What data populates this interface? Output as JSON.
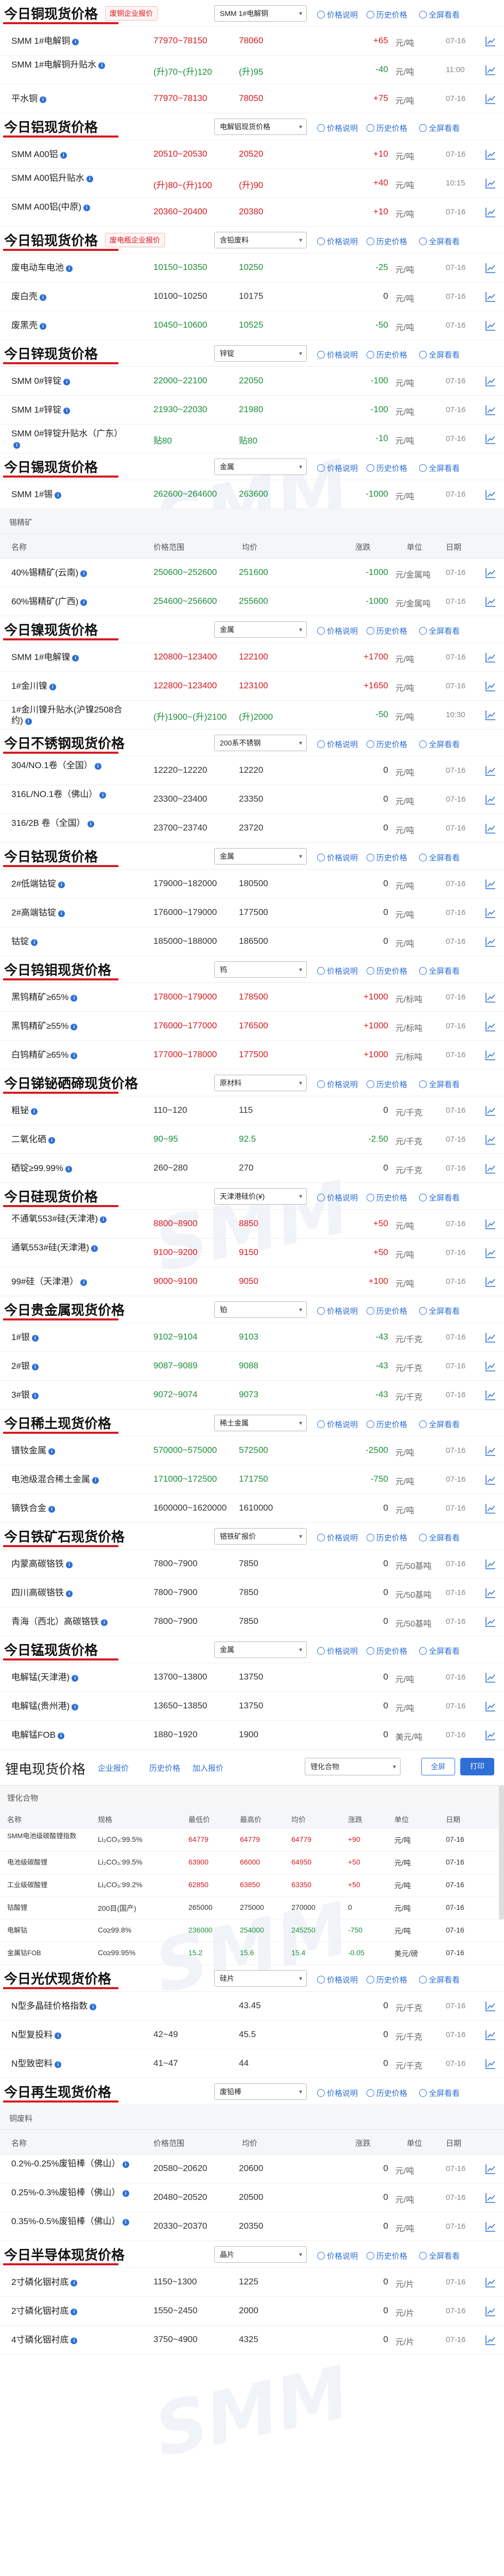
{
  "links": {
    "info": "价格说明",
    "history": "历史价格",
    "chart": "全屏看看"
  },
  "sections": [
    {
      "id": "copper",
      "title": "今日铜现货价格",
      "chip": "废铜企业报价",
      "select": "SMM 1#电解铜",
      "rows": [
        {
          "name": "SMM 1#电解铜",
          "range": "77970~78150",
          "avg": "78060",
          "chg": "+65",
          "unit": "元/吨",
          "date": "07-16",
          "dir": "up"
        },
        {
          "name": "SMM 1#电解铜升贴水",
          "range": "(升)70~(升)120",
          "avg": "(升)95",
          "chg": "-40",
          "unit": "元/吨",
          "date": "11:00",
          "dir": "dn"
        },
        {
          "name": "平水铜",
          "range": "77970~78130",
          "avg": "78050",
          "chg": "+75",
          "unit": "元/吨",
          "date": "07-16",
          "dir": "up"
        }
      ]
    },
    {
      "id": "aluminum",
      "title": "今日铝现货价格",
      "select": "电解铝现货价格",
      "rows": [
        {
          "name": "SMM A00铝",
          "range": "20510~20530",
          "avg": "20520",
          "chg": "+10",
          "unit": "元/吨",
          "date": "07-16",
          "dir": "up"
        },
        {
          "name": "SMM A00铝升贴水",
          "range": "(升)80~(升)100",
          "avg": "(升)90",
          "chg": "+40",
          "unit": "元/吨",
          "date": "10:15",
          "dir": "up"
        },
        {
          "name": "SMM A00铝(中原)",
          "range": "20360~20400",
          "avg": "20380",
          "chg": "+10",
          "unit": "元/吨",
          "date": "07-16",
          "dir": "up"
        }
      ]
    },
    {
      "id": "lead",
      "title": "今日铅现货价格",
      "chip": "废电瓶企业报价",
      "select": "含铅废料",
      "rows": [
        {
          "name": "废电动车电池",
          "range": "10150~10350",
          "avg": "10250",
          "chg": "-25",
          "unit": "元/吨",
          "date": "07-16",
          "dir": "dn"
        },
        {
          "name": "废白壳",
          "range": "10100~10250",
          "avg": "10175",
          "chg": "0",
          "unit": "元/吨",
          "date": "07-16",
          "dir": "zero"
        },
        {
          "name": "废黑壳",
          "range": "10450~10600",
          "avg": "10525",
          "chg": "-50",
          "unit": "元/吨",
          "date": "07-16",
          "dir": "dn"
        }
      ]
    },
    {
      "id": "zinc",
      "title": "今日锌现货价格",
      "select": "锌锭",
      "rows": [
        {
          "name": "SMM 0#锌锭",
          "range": "22000~22100",
          "avg": "22050",
          "chg": "-100",
          "unit": "元/吨",
          "date": "07-16",
          "dir": "dn"
        },
        {
          "name": "SMM 1#锌锭",
          "range": "21930~22030",
          "avg": "21980",
          "chg": "-100",
          "unit": "元/吨",
          "date": "07-16",
          "dir": "dn"
        },
        {
          "name": "SMM 0#锌锭升贴水（广东）",
          "range": "贴80",
          "avg": "贴80",
          "chg": "-10",
          "unit": "元/吨",
          "date": "07-16",
          "dir": "dn"
        }
      ]
    },
    {
      "id": "tin",
      "title": "今日锡现货价格",
      "select": "金属",
      "rows": [
        {
          "name": "SMM 1#锡",
          "range": "262600~264600",
          "avg": "263600",
          "chg": "-1000",
          "unit": "元/吨",
          "date": "07-16",
          "dir": "dn"
        }
      ],
      "sub": {
        "label": "锡精矿",
        "cols": {
          "name": "名称",
          "range": "价格范围",
          "avg": "均价",
          "chg": "涨跌",
          "unit": "单位",
          "date": "日期"
        },
        "rows": [
          {
            "name": "40%锡精矿(云南)",
            "range": "250600~252600",
            "avg": "251600",
            "chg": "-1000",
            "unit": "元/金属吨",
            "date": "07-16",
            "dir": "dn"
          },
          {
            "name": "60%锡精矿(广西)",
            "range": "254600~256600",
            "avg": "255600",
            "chg": "-1000",
            "unit": "元/金属吨",
            "date": "07-16",
            "dir": "dn"
          }
        ]
      }
    },
    {
      "id": "nickel",
      "title": "今日镍现货价格",
      "select": "金属",
      "rows": [
        {
          "name": "SMM 1#电解镍",
          "range": "120800~123400",
          "avg": "122100",
          "chg": "+1700",
          "unit": "元/吨",
          "date": "07-16",
          "dir": "up"
        },
        {
          "name": "1#金川镍",
          "range": "122800~123400",
          "avg": "123100",
          "chg": "+1650",
          "unit": "元/吨",
          "date": "07-16",
          "dir": "up"
        },
        {
          "name": "1#金川镍升贴水(沪镍2508合约)",
          "range": "(升)1900~(升)2100",
          "avg": "(升)2000",
          "chg": "-50",
          "unit": "元/吨",
          "date": "10:30",
          "dir": "dn"
        }
      ]
    },
    {
      "id": "stainless",
      "title": "今日不锈钢现货价格",
      "select": "200系不锈钢",
      "rows": [
        {
          "name": "304/NO.1卷（全国）",
          "range": "12220~12220",
          "avg": "12220",
          "chg": "0",
          "unit": "元/吨",
          "date": "07-16",
          "dir": "zero"
        },
        {
          "name": "316L/NO.1卷（佛山）",
          "range": "23300~23400",
          "avg": "23350",
          "chg": "0",
          "unit": "元/吨",
          "date": "07-16",
          "dir": "zero"
        },
        {
          "name": "316/2B 卷（全国）",
          "range": "23700~23740",
          "avg": "23720",
          "chg": "0",
          "unit": "元/吨",
          "date": "07-16",
          "dir": "zero"
        }
      ]
    },
    {
      "id": "cobalt",
      "title": "今日钴现货价格",
      "select": "金属",
      "rows": [
        {
          "name": "2#低端钴锭",
          "range": "179000~182000",
          "avg": "180500",
          "chg": "0",
          "unit": "元/吨",
          "date": "07-16",
          "dir": "zero"
        },
        {
          "name": "2#高端钴锭",
          "range": "176000~179000",
          "avg": "177500",
          "chg": "0",
          "unit": "元/吨",
          "date": "07-16",
          "dir": "zero"
        },
        {
          "name": "钴锭",
          "range": "185000~188000",
          "avg": "186500",
          "chg": "0",
          "unit": "元/吨",
          "date": "07-16",
          "dir": "zero"
        }
      ]
    },
    {
      "id": "tungsten",
      "title": "今日钨钼现货价格",
      "select": "钨",
      "rows": [
        {
          "name": "黑钨精矿≥65%",
          "range": "178000~179000",
          "avg": "178500",
          "chg": "+1000",
          "unit": "元/标吨",
          "date": "07-16",
          "dir": "up"
        },
        {
          "name": "黑钨精矿≥55%",
          "range": "176000~177000",
          "avg": "176500",
          "chg": "+1000",
          "unit": "元/标吨",
          "date": "07-16",
          "dir": "up"
        },
        {
          "name": "白钨精矿≥65%",
          "range": "177000~178000",
          "avg": "177500",
          "chg": "+1000",
          "unit": "元/标吨",
          "date": "07-16",
          "dir": "up"
        }
      ]
    },
    {
      "id": "antimony",
      "title": "今日锑铋硒碲现货价格",
      "select": "原材料",
      "rows": [
        {
          "name": "粗铋",
          "range": "110~120",
          "avg": "115",
          "chg": "0",
          "unit": "元/千克",
          "date": "07-16",
          "dir": "zero"
        },
        {
          "name": "二氧化硒",
          "range": "90~95",
          "avg": "92.5",
          "chg": "-2.50",
          "unit": "元/千克",
          "date": "07-16",
          "dir": "dn"
        },
        {
          "name": "硒锭≥99.99%",
          "range": "260~280",
          "avg": "270",
          "chg": "0",
          "unit": "元/千克",
          "date": "07-16",
          "dir": "zero"
        }
      ]
    },
    {
      "id": "silicon",
      "title": "今日硅现货价格",
      "select": "天津港硅价(¥)",
      "rows": [
        {
          "name": "不通氧553#硅(天津港)",
          "range": "8800~8900",
          "avg": "8850",
          "chg": "+50",
          "unit": "元/吨",
          "date": "07-16",
          "dir": "up"
        },
        {
          "name": "通氧553#硅(天津港)",
          "range": "9100~9200",
          "avg": "9150",
          "chg": "+50",
          "unit": "元/吨",
          "date": "07-16",
          "dir": "up"
        },
        {
          "name": "99#硅（天津港）",
          "range": "9000~9100",
          "avg": "9050",
          "chg": "+100",
          "unit": "元/吨",
          "date": "07-16",
          "dir": "up"
        }
      ]
    },
    {
      "id": "precious",
      "title": "今日贵金属现货价格",
      "select": "铂",
      "rows": [
        {
          "name": "1#银",
          "range": "9102~9104",
          "avg": "9103",
          "chg": "-43",
          "unit": "元/千克",
          "date": "07-16",
          "dir": "dn"
        },
        {
          "name": "2#银",
          "range": "9087~9089",
          "avg": "9088",
          "chg": "-43",
          "unit": "元/千克",
          "date": "07-16",
          "dir": "dn"
        },
        {
          "name": "3#银",
          "range": "9072~9074",
          "avg": "9073",
          "chg": "-43",
          "unit": "元/千克",
          "date": "07-16",
          "dir": "dn"
        }
      ]
    },
    {
      "id": "rareearth",
      "title": "今日稀土现货价格",
      "select": "稀土金属",
      "rows": [
        {
          "name": "镨钕金属",
          "range": "570000~575000",
          "avg": "572500",
          "chg": "-2500",
          "unit": "元/吨",
          "date": "07-16",
          "dir": "dn"
        },
        {
          "name": "电池级混合稀土金属",
          "range": "171000~172500",
          "avg": "171750",
          "chg": "-750",
          "unit": "元/吨",
          "date": "07-16",
          "dir": "dn"
        },
        {
          "name": "镝铁合金",
          "range": "1600000~1620000",
          "avg": "1610000",
          "chg": "0",
          "unit": "元/吨",
          "date": "07-16",
          "dir": "zero"
        }
      ]
    },
    {
      "id": "ore",
      "title": "今日铁矿石现货价格",
      "select": "铬铁矿报价",
      "rows": [
        {
          "name": "内蒙高碳铬铁",
          "range": "7800~7900",
          "avg": "7850",
          "chg": "0",
          "unit": "元/50基吨",
          "date": "07-16",
          "dir": "zero"
        },
        {
          "name": "四川高碳铬铁",
          "range": "7800~7900",
          "avg": "7850",
          "chg": "0",
          "unit": "元/50基吨",
          "date": "07-16",
          "dir": "zero"
        },
        {
          "name": "青海（西北）高碳铬铁",
          "range": "7800~7900",
          "avg": "7850",
          "chg": "0",
          "unit": "元/50基吨",
          "date": "07-16",
          "dir": "zero"
        }
      ]
    },
    {
      "id": "manganese",
      "title": "今日锰现货价格",
      "select": "金属",
      "rows": [
        {
          "name": "电解锰(天津港)",
          "range": "13700~13800",
          "avg": "13750",
          "chg": "0",
          "unit": "元/吨",
          "date": "07-16",
          "dir": "zero"
        },
        {
          "name": "电解锰(贵州港)",
          "range": "13650~13850",
          "avg": "13750",
          "chg": "0",
          "unit": "元/吨",
          "date": "07-16",
          "dir": "zero"
        },
        {
          "name": "电解锰FOB",
          "range": "1880~1920",
          "avg": "1900",
          "chg": "0",
          "unit": "美元/吨",
          "date": "07-16",
          "dir": "zero"
        }
      ]
    }
  ],
  "lithium": {
    "title": "锂电现货价格",
    "links": [
      "企业报价",
      "历史价格",
      "加入报价"
    ],
    "select": "锂化合物",
    "btn_full": "全屏",
    "btn_print": "打印",
    "group": "锂化合物",
    "cols": [
      "名称",
      "规格",
      "最低价",
      "最高价",
      "均价",
      "涨跌",
      "单位",
      "日期"
    ],
    "rows": [
      {
        "name": "SMM电池级碳酸锂指数",
        "spec": "Li₂CO₃:99.5%",
        "low": "64779",
        "high": "64779",
        "avg": "64779",
        "chg": "+90",
        "unit": "元/吨",
        "date": "07-16",
        "dir": "up"
      },
      {
        "name": "电池级碳酸锂",
        "spec": "Li₂CO₃:99.5%",
        "low": "63900",
        "high": "66000",
        "avg": "64950",
        "chg": "+50",
        "unit": "元/吨",
        "date": "07-16",
        "dir": "up"
      },
      {
        "name": "工业级碳酸锂",
        "spec": "Li₂CO₃:99.2%",
        "low": "62850",
        "high": "63850",
        "avg": "63350",
        "chg": "+50",
        "unit": "元/吨",
        "date": "07-16",
        "dir": "up"
      },
      {
        "name": "钴酸锂",
        "spec": "200目(国产)",
        "low": "265000",
        "high": "275000",
        "avg": "270000",
        "chg": "0",
        "unit": "元/吨",
        "date": "07-16",
        "dir": "zero"
      },
      {
        "name": "电解钴",
        "spec": "Co≥99.8%",
        "low": "236000",
        "high": "254000",
        "avg": "245250",
        "chg": "-750",
        "unit": "元/吨",
        "date": "07-16",
        "dir": "dn"
      },
      {
        "name": "金属钴FOB",
        "spec": "Co≥99.95%",
        "low": "15.2",
        "high": "15.6",
        "avg": "15.4",
        "chg": "-0.05",
        "unit": "美元/磅",
        "date": "07-16",
        "dir": "dn"
      }
    ]
  },
  "tail_sections": [
    {
      "id": "pv",
      "title": "今日光伏现货价格",
      "select": "硅片",
      "rows": [
        {
          "name": "N型多晶硅价格指数",
          "range": "",
          "avg": "43.45",
          "chg": "0",
          "unit": "元/千克",
          "date": "07-16",
          "dir": "zero"
        },
        {
          "name": "N型复投料",
          "range": "42~49",
          "avg": "45.5",
          "chg": "0",
          "unit": "元/千克",
          "date": "07-16",
          "dir": "zero"
        },
        {
          "name": "N型致密料",
          "range": "41~47",
          "avg": "44",
          "chg": "0",
          "unit": "元/千克",
          "date": "07-16",
          "dir": "zero"
        }
      ]
    },
    {
      "id": "recycle",
      "title": "今日再生现货价格",
      "select": "废铅棒",
      "sub": {
        "label": "铜废料",
        "cols": {
          "name": "名称",
          "range": "价格范围",
          "avg": "均价",
          "chg": "涨跌",
          "unit": "单位",
          "date": "日期"
        },
        "rows": [
          {
            "name": "0.2%-0.25%废铅棒（佛山）",
            "range": "20580~20620",
            "avg": "20600",
            "chg": "0",
            "unit": "元/吨",
            "date": "07-16",
            "dir": "zero"
          },
          {
            "name": "0.25%-0.3%废铅棒（佛山）",
            "range": "20480~20520",
            "avg": "20500",
            "chg": "0",
            "unit": "元/吨",
            "date": "07-16",
            "dir": "zero"
          },
          {
            "name": "0.35%-0.5%废铅棒（佛山）",
            "range": "20330~20370",
            "avg": "20350",
            "chg": "0",
            "unit": "元/吨",
            "date": "07-16",
            "dir": "zero"
          }
        ]
      }
    },
    {
      "id": "semi",
      "title": "今日半导体现货价格",
      "select": "晶片",
      "rows": [
        {
          "name": "2寸磷化铟衬底",
          "range": "1150~1300",
          "avg": "1225",
          "chg": "0",
          "unit": "元/片",
          "date": "07-16",
          "dir": "zero"
        },
        {
          "name": "2寸磷化铟衬底",
          "range": "1550~2450",
          "avg": "2000",
          "chg": "0",
          "unit": "元/片",
          "date": "07-16",
          "dir": "zero"
        },
        {
          "name": "4寸磷化铟衬底",
          "range": "3750~4900",
          "avg": "4325",
          "chg": "0",
          "unit": "元/片",
          "date": "07-16",
          "dir": "zero"
        }
      ]
    }
  ]
}
